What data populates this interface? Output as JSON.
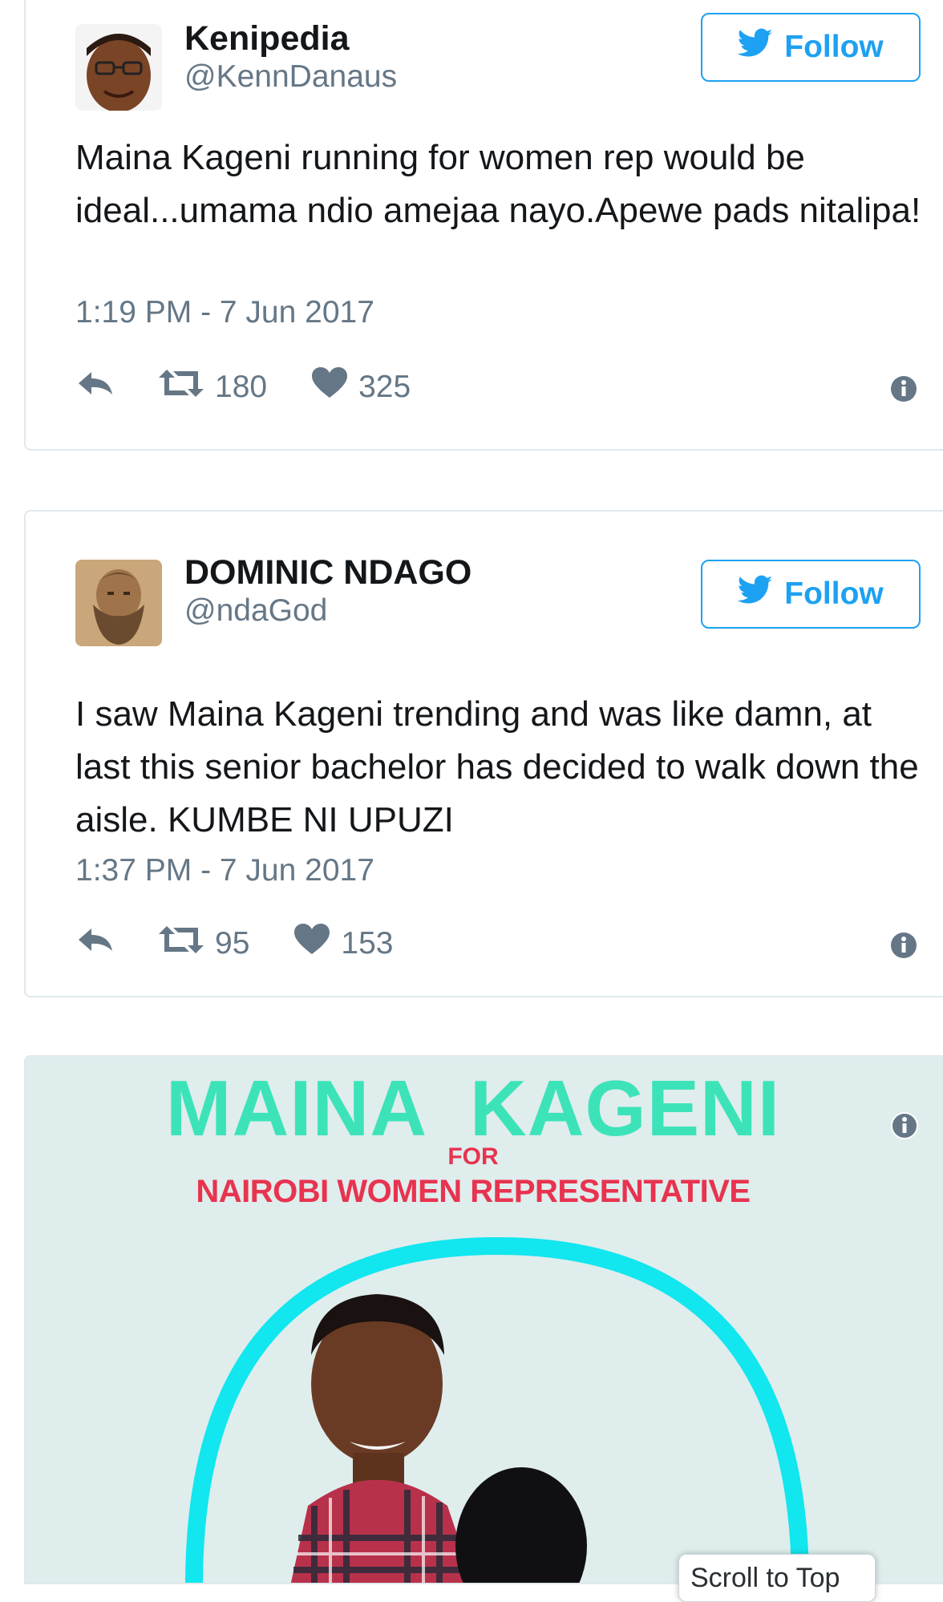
{
  "tweets": [
    {
      "display_name": "Kenipedia",
      "handle": "@KennDanaus",
      "follow_label": "Follow",
      "text": "Maina Kageni running for women rep would be ideal...umama ndio amejaa nayo.Apewe pads nitalipa!",
      "timestamp": "1:19 PM - 7 Jun 2017",
      "retweets": "180",
      "likes": "325"
    },
    {
      "display_name": "DOMINIC NDAGO",
      "handle": "@ndaGod",
      "follow_label": "Follow",
      "text": "I saw Maina Kageni trending and was like damn, at last this senior bachelor has decided to walk down the aisle. KUMBE NI UPUZI",
      "timestamp": "1:37 PM - 7 Jun 2017",
      "retweets": "95",
      "likes": "153"
    }
  ],
  "poster": {
    "title": "MAINA  KAGENI",
    "for": "FOR",
    "subtitle": "NAIROBI WOMEN REPRESENTATIVE"
  },
  "scroll_to_top": "Scroll to Top",
  "colors": {
    "twitter_blue": "#1da1f2",
    "muted": "#657786",
    "poster_teal": "#3de3b8",
    "poster_red": "#e8334f",
    "poster_ring": "#12e6ee"
  },
  "icons": [
    "twitter-bird-icon",
    "reply-icon",
    "retweet-icon",
    "heart-icon",
    "info-icon"
  ]
}
